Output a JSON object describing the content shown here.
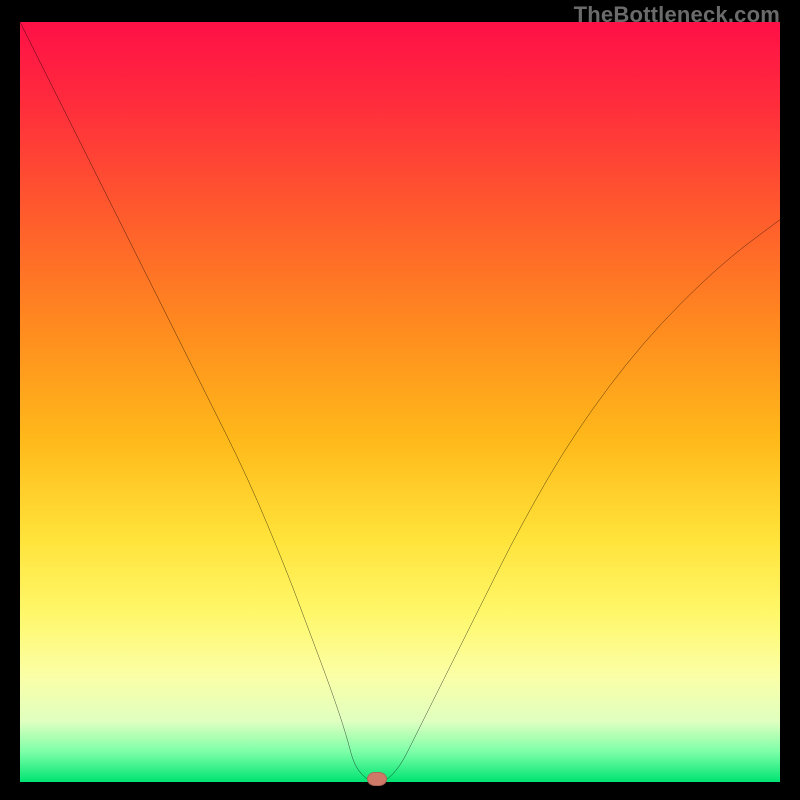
{
  "watermark": "TheBottleneck.com",
  "chart_data": {
    "type": "line",
    "title": "",
    "xlabel": "",
    "ylabel": "",
    "xlim": [
      0,
      100
    ],
    "ylim": [
      0,
      100
    ],
    "grid": false,
    "legend": false,
    "background": "red-to-green vertical gradient",
    "series": [
      {
        "name": "bottleneck-curve",
        "x": [
          0,
          6,
          12,
          18,
          24,
          30,
          35,
          38,
          41,
          43,
          44,
          46,
          47,
          48,
          50,
          52,
          55,
          60,
          66,
          73,
          82,
          92,
          100
        ],
        "values": [
          100,
          88,
          76,
          64,
          52,
          40,
          28,
          20,
          12,
          6,
          2,
          0,
          0,
          0,
          2,
          6,
          12,
          22,
          34,
          46,
          58,
          68,
          74
        ]
      }
    ],
    "marker": {
      "x": 47,
      "y": 0,
      "color": "#cf7a68"
    },
    "gradient_stops": [
      {
        "pos": 0,
        "color": "#ff1047"
      },
      {
        "pos": 10,
        "color": "#ff2a3d"
      },
      {
        "pos": 25,
        "color": "#ff5a2d"
      },
      {
        "pos": 40,
        "color": "#ff8a1f"
      },
      {
        "pos": 55,
        "color": "#ffb91a"
      },
      {
        "pos": 68,
        "color": "#ffe33a"
      },
      {
        "pos": 78,
        "color": "#fff86b"
      },
      {
        "pos": 86,
        "color": "#fbffa6"
      },
      {
        "pos": 92,
        "color": "#e0ffc0"
      },
      {
        "pos": 96,
        "color": "#7dffa8"
      },
      {
        "pos": 100,
        "color": "#00e472"
      }
    ]
  }
}
